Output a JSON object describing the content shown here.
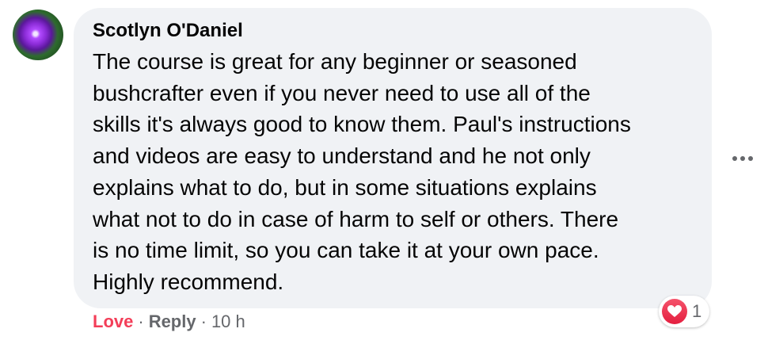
{
  "comment": {
    "author": "Scotlyn O'Daniel",
    "text_lines": [
      "The course is great for any beginner or seasoned",
      "bushcrafter even if you never need to use all of the",
      "skills it's always good to know them. Paul's instructions",
      "and videos are easy to understand and he not only",
      "explains what to do, but in some situations explains",
      "what not to do in case of harm to self or others. There",
      "is no time limit, so you can take it at your own pace.",
      "Highly recommend."
    ],
    "reaction": {
      "icon": "heart-icon",
      "count": "1"
    },
    "actions": {
      "love_label": "Love",
      "separator": "·",
      "reply_label": "Reply",
      "timestamp": "10 h"
    }
  },
  "colors": {
    "bubble": "#f0f2f5",
    "love": "#f33e58",
    "secondary_text": "#65676b"
  }
}
